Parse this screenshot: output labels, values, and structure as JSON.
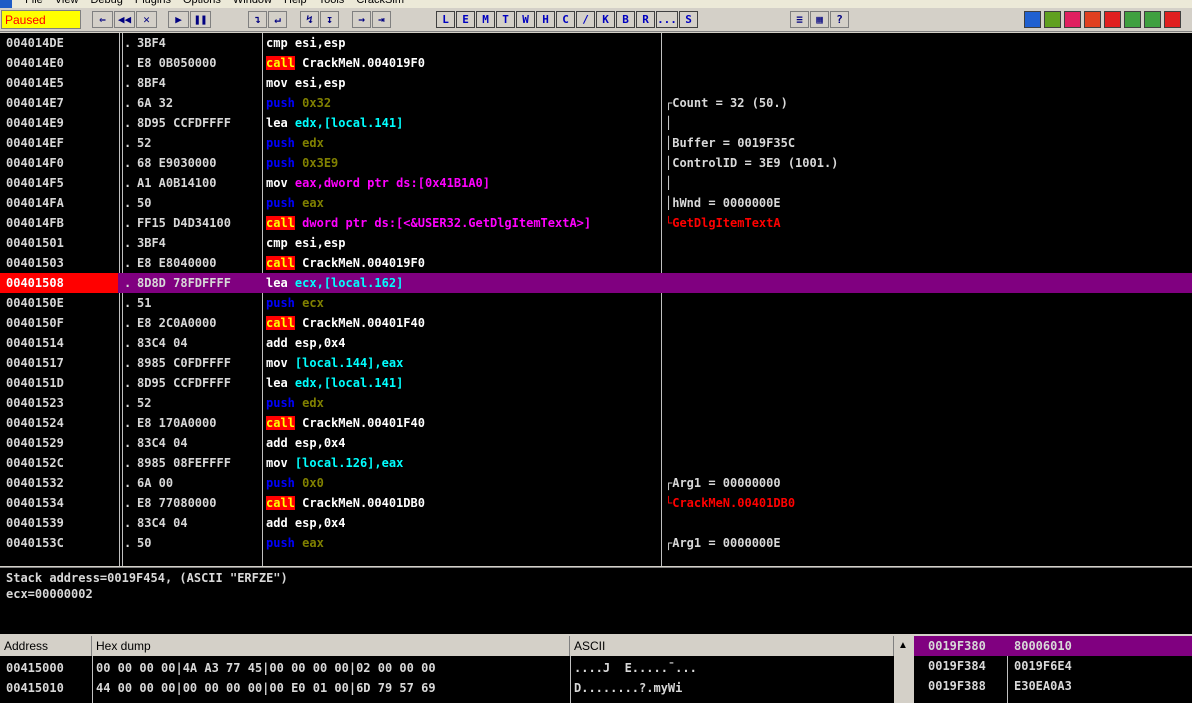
{
  "menu": [
    "File",
    "View",
    "Debug",
    "Plugins",
    "Options",
    "Window",
    "Help",
    "Tools",
    "CrackSim"
  ],
  "toolbar": {
    "state": "Paused",
    "nav_buttons": [
      "⇐",
      "◀◀",
      "✕",
      "▶",
      "❚❚"
    ],
    "step_buttons": [
      "↴",
      "↵",
      "↯",
      "↧",
      "→",
      "⇥"
    ],
    "letter_buttons": [
      "L",
      "E",
      "M",
      "T",
      "W",
      "H",
      "C",
      "/",
      "K",
      "B",
      "R",
      "...",
      "S"
    ],
    "misc_buttons": [
      "≡",
      "▦",
      "?"
    ]
  },
  "cpu": {
    "rows": [
      {
        "addr": "004014DE",
        "dot": ".",
        "hex": "3BF4",
        "mn": "cmp",
        "mk": "mov",
        "op": "esi,esp",
        "ok": "def",
        "cmt": ""
      },
      {
        "addr": "004014E0",
        "dot": ".",
        "hex": "E8 0B050000",
        "mn": "call",
        "mk": "call",
        "op": "CrackMeN.004019F0",
        "ok": "call",
        "cmt": ""
      },
      {
        "addr": "004014E5",
        "dot": ".",
        "hex": "8BF4",
        "mn": "mov",
        "mk": "mov",
        "op": "esi,esp",
        "ok": "def",
        "cmt": ""
      },
      {
        "addr": "004014E7",
        "dot": ".",
        "hex": "6A 32",
        "mn": "push",
        "mk": "push",
        "op": "0x32",
        "ok": "push",
        "cmt": "┌Count = 32 (50.)"
      },
      {
        "addr": "004014E9",
        "dot": ".",
        "hex": "8D95 CCFDFFFF",
        "mn": "lea",
        "mk": "mov",
        "op": "edx,[local.141]",
        "ok": "local",
        "cmt": "│"
      },
      {
        "addr": "004014EF",
        "dot": ".",
        "hex": "52",
        "mn": "push",
        "mk": "push",
        "op": "edx",
        "ok": "push",
        "cmt": "│Buffer = 0019F35C"
      },
      {
        "addr": "004014F0",
        "dot": ".",
        "hex": "68 E9030000",
        "mn": "push",
        "mk": "push",
        "op": "0x3E9",
        "ok": "push",
        "cmt": "│ControlID = 3E9 (1001.)"
      },
      {
        "addr": "004014F5",
        "dot": ".",
        "hex": "A1 A0B14100",
        "mn": "mov",
        "mk": "mov",
        "op": "eax,dword ptr ds:[0x41B1A0]",
        "ok": "ptr",
        "cmt": "│"
      },
      {
        "addr": "004014FA",
        "dot": ".",
        "hex": "50",
        "mn": "push",
        "mk": "push",
        "op": "eax",
        "ok": "push",
        "cmt": "│hWnd = 0000000E"
      },
      {
        "addr": "004014FB",
        "dot": ".",
        "hex": "FF15 D4D34100",
        "mn": "call",
        "mk": "call",
        "op": "dword ptr ds:[<&USER32.GetDlgItemTextA>]",
        "ok": "ptr",
        "cmt": "└GetDlgItemTextA",
        "red": true
      },
      {
        "addr": "00401501",
        "dot": ".",
        "hex": "3BF4",
        "mn": "cmp",
        "mk": "mov",
        "op": "esi,esp",
        "ok": "def",
        "cmt": ""
      },
      {
        "addr": "00401503",
        "dot": ".",
        "hex": "E8 E8040000",
        "mn": "call",
        "mk": "call",
        "op": "CrackMeN.004019F0",
        "ok": "call",
        "cmt": ""
      },
      {
        "addr": "00401508",
        "dot": ".",
        "hex": "8D8D 78FDFFFF",
        "mn": "lea",
        "mk": "mov",
        "op": "ecx,[local.162]",
        "ok": "local",
        "cmt": "",
        "sel": true
      },
      {
        "addr": "0040150E",
        "dot": ".",
        "hex": "51",
        "mn": "push",
        "mk": "push",
        "op": "ecx",
        "ok": "push",
        "cmt": ""
      },
      {
        "addr": "0040150F",
        "dot": ".",
        "hex": "E8 2C0A0000",
        "mn": "call",
        "mk": "call",
        "op": "CrackMeN.00401F40",
        "ok": "call",
        "cmt": ""
      },
      {
        "addr": "00401514",
        "dot": ".",
        "hex": "83C4 04",
        "mn": "add",
        "mk": "mov",
        "op": "esp,0x4",
        "ok": "def",
        "cmt": ""
      },
      {
        "addr": "00401517",
        "dot": ".",
        "hex": "8985 C0FDFFFF",
        "mn": "mov",
        "mk": "mov",
        "op": "[local.144],eax",
        "ok": "local",
        "cmt": ""
      },
      {
        "addr": "0040151D",
        "dot": ".",
        "hex": "8D95 CCFDFFFF",
        "mn": "lea",
        "mk": "mov",
        "op": "edx,[local.141]",
        "ok": "local",
        "cmt": ""
      },
      {
        "addr": "00401523",
        "dot": ".",
        "hex": "52",
        "mn": "push",
        "mk": "push",
        "op": "edx",
        "ok": "push",
        "cmt": ""
      },
      {
        "addr": "00401524",
        "dot": ".",
        "hex": "E8 170A0000",
        "mn": "call",
        "mk": "call",
        "op": "CrackMeN.00401F40",
        "ok": "call",
        "cmt": ""
      },
      {
        "addr": "00401529",
        "dot": ".",
        "hex": "83C4 04",
        "mn": "add",
        "mk": "mov",
        "op": "esp,0x4",
        "ok": "def",
        "cmt": ""
      },
      {
        "addr": "0040152C",
        "dot": ".",
        "hex": "8985 08FEFFFF",
        "mn": "mov",
        "mk": "mov",
        "op": "[local.126],eax",
        "ok": "local",
        "cmt": ""
      },
      {
        "addr": "00401532",
        "dot": ".",
        "hex": "6A 00",
        "mn": "push",
        "mk": "push",
        "op": "0x0",
        "ok": "push",
        "cmt": "┌Arg1 = 00000000"
      },
      {
        "addr": "00401534",
        "dot": ".",
        "hex": "E8 77080000",
        "mn": "call",
        "mk": "call",
        "op": "CrackMeN.00401DB0",
        "ok": "call",
        "cmt": "└CrackMeN.00401DB0",
        "red": true
      },
      {
        "addr": "00401539",
        "dot": ".",
        "hex": "83C4 04",
        "mn": "add",
        "mk": "mov",
        "op": "esp,0x4",
        "ok": "def",
        "cmt": ""
      },
      {
        "addr": "0040153C",
        "dot": ".",
        "hex": "50",
        "mn": "push",
        "mk": "push",
        "op": "eax",
        "ok": "push",
        "cmt": "┌Arg1 = 0000000E"
      }
    ]
  },
  "info": {
    "line1": "Stack address=0019F454, (ASCII \"ERFZE\")",
    "line2": "ecx=00000002"
  },
  "dump": {
    "headers": {
      "address": "Address",
      "hex": "Hex dump",
      "ascii": "ASCII"
    },
    "rows": [
      {
        "addr": "00415000",
        "hex": "00 00 00 00|4A A3 77 45|00 00 00 00|02 00 00 00",
        "ascii": "....J  E.....¯..."
      },
      {
        "addr": "00415010",
        "hex": "44 00 00 00|00 00 00 00|00 E0 01 00|6D 79 57 69",
        "ascii": "D........?.myWi"
      }
    ]
  },
  "stack": {
    "rows": [
      {
        "addr": "0019F380",
        "val": "80006010",
        "sel": true
      },
      {
        "addr": "0019F384",
        "val": "0019F6E4"
      },
      {
        "addr": "0019F388",
        "val": "E30EA0A3"
      }
    ]
  },
  "colors": {
    "window_bg": "#000000",
    "selected_row": "#800080",
    "eip_addr": "#ff0000",
    "call_bg": "#ff0000",
    "call_fg": "#ffff00",
    "push_fg": "#0000ff",
    "local_fg": "#00ffff",
    "ptr_fg": "#ff00ff"
  }
}
